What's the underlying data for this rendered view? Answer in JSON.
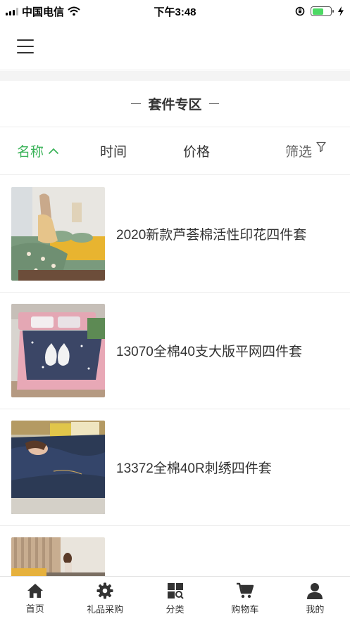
{
  "status_bar": {
    "carrier": "中国电信",
    "time": "下午3:48",
    "battery_level": 0.6
  },
  "header": {
    "menu_icon": "hamburger-menu-icon"
  },
  "section": {
    "title": "套件专区"
  },
  "sort_bar": {
    "items": [
      {
        "label": "名称",
        "icon": "chevron-up-icon",
        "active": true
      },
      {
        "label": "时间"
      },
      {
        "label": "价格"
      },
      {
        "label": "筛选",
        "icon": "filter-icon"
      }
    ]
  },
  "products": [
    {
      "name": "2020新款芦荟棉活性印花四件套",
      "image": "green floral bedding set"
    },
    {
      "name": "13070全棉40支大版平网四件套",
      "image": "navy and pink cat print bedding set"
    },
    {
      "name": "13372全棉40R刺绣四件套",
      "image": "navy embroidered bedding set"
    },
    {
      "name": "",
      "image": "bedroom bedding set (partially visible)"
    }
  ],
  "tab_bar": {
    "tabs": [
      {
        "label": "首页",
        "icon": "home-icon"
      },
      {
        "label": "礼品采购",
        "icon": "gear-icon"
      },
      {
        "label": "分类",
        "icon": "category-search-icon"
      },
      {
        "label": "购物车",
        "icon": "cart-icon"
      },
      {
        "label": "我的",
        "icon": "user-icon"
      }
    ]
  },
  "colors": {
    "accent": "#3cb35a",
    "battery": "#4cd964",
    "divider": "#ececec"
  }
}
